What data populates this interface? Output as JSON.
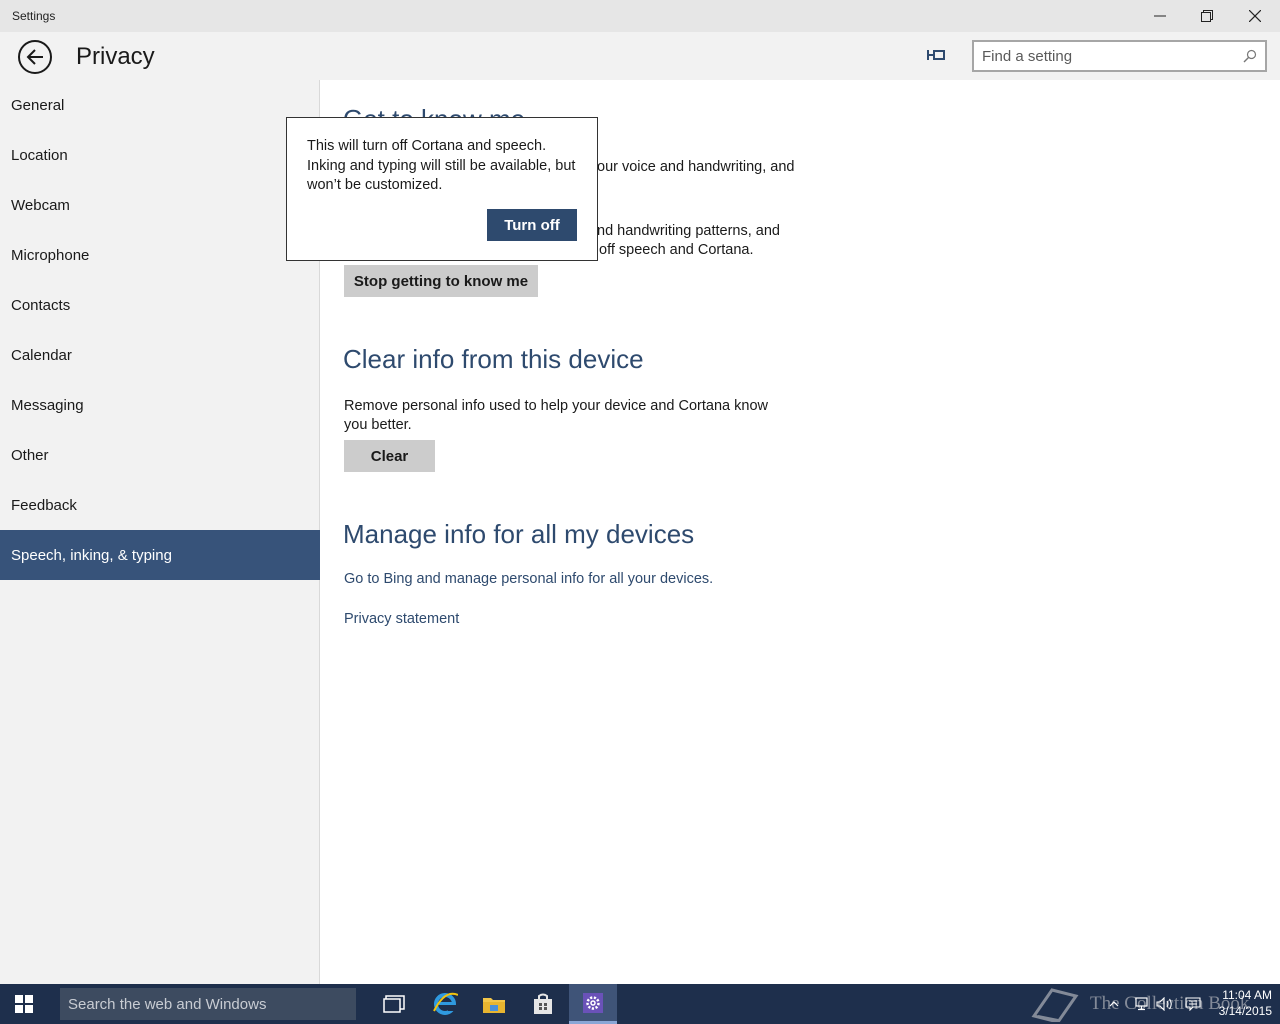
{
  "window": {
    "title": "Settings"
  },
  "header": {
    "page_title": "Privacy",
    "search_placeholder": "Find a setting"
  },
  "sidebar": {
    "items": [
      {
        "label": "General"
      },
      {
        "label": "Location"
      },
      {
        "label": "Webcam"
      },
      {
        "label": "Microphone"
      },
      {
        "label": "Contacts"
      },
      {
        "label": "Calendar"
      },
      {
        "label": "Messaging"
      },
      {
        "label": "Other"
      },
      {
        "label": "Feedback"
      },
      {
        "label": "Speech, inking, & typing",
        "selected": true
      }
    ]
  },
  "main": {
    "section1": {
      "heading": "Get to know me",
      "para1_visible_fragment": "our voice and handwriting, and",
      "para2_visible_line1": "nd handwriting patterns, and",
      "para2_visible_line2": "off speech and Cortana.",
      "button": "Stop getting to know me"
    },
    "section2": {
      "heading": "Clear info from this device",
      "text": "Remove personal info used to help your device and Cortana know you better.",
      "button": "Clear"
    },
    "section3": {
      "heading": "Manage info for all my devices",
      "link": "Go to Bing and manage personal info for all your devices."
    },
    "privacy_link": "Privacy statement"
  },
  "flyout": {
    "text": "This will turn off Cortana and speech. Inking and typing will still be available, but won’t be customized.",
    "button": "Turn off"
  },
  "taskbar": {
    "search_placeholder": "Search the web and Windows",
    "time": "11:04 AM",
    "date": "3/14/2015",
    "watermark": "The Collection Book"
  },
  "colors": {
    "accent": "#37537a",
    "heading": "#2e4a6e",
    "taskbar": "#1e2f4c"
  }
}
